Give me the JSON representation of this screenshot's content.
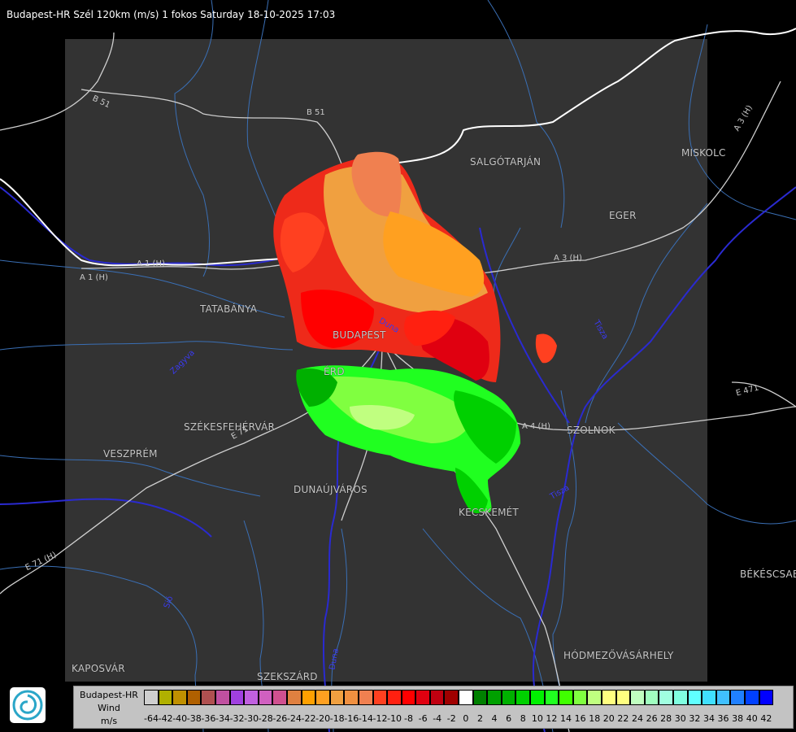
{
  "header": {
    "title": "Budapest-HR Szél 120km (m/s) 1 fokos Saturday 18-10-2025 17:03"
  },
  "map": {
    "cities": [
      {
        "name": "SALGÓTARJÁN"
      },
      {
        "name": "MISKOLC"
      },
      {
        "name": "EGER"
      },
      {
        "name": "TATABÁNYA"
      },
      {
        "name": "BUDAPEST"
      },
      {
        "name": "ÉRD"
      },
      {
        "name": "SZÉKESFEHÉRVÁR"
      },
      {
        "name": "VESZPRÉM"
      },
      {
        "name": "SZOLNOK"
      },
      {
        "name": "DUNAÚJVÁROS"
      },
      {
        "name": "KECSKEMÉT"
      },
      {
        "name": "BÉKÉSCSABA"
      },
      {
        "name": "HÓDMEZŐVÁSÁRHELY"
      },
      {
        "name": "KAPOSVÁR"
      },
      {
        "name": "SZEKSZÁRD"
      }
    ],
    "roads": [
      "B 51",
      "B 51",
      "A 3 (H)",
      "A 3 (H)",
      "A 1 (H)",
      "A 1 (H)",
      "A 4 (H)",
      "E 71",
      "E 71",
      "E 471",
      "E 71 (H)"
    ],
    "rivers": [
      "Duna",
      "Duna",
      "Tisza",
      "Tisza",
      "Zagyva",
      "Sió"
    ],
    "colors": {
      "radar_bg": "#333333",
      "border": "#ffffff",
      "rivers": "#2a2ad0",
      "boundaries": "#3a6fb5",
      "roads": "#cfcfcf"
    }
  },
  "legend": {
    "title": "Budapest-HR",
    "quantity": "Wind",
    "unit": "m/s",
    "ticks": [
      "-64",
      "-42",
      "-40",
      "-38",
      "-36",
      "-34",
      "-32",
      "-30",
      "-28",
      "-26",
      "-24",
      "-22",
      "-20",
      "-18",
      "-16",
      "-14",
      "-12",
      "-10",
      "-8",
      "-6",
      "-4",
      "-2",
      "0",
      "2",
      "4",
      "6",
      "8",
      "10",
      "12",
      "14",
      "16",
      "18",
      "20",
      "22",
      "24",
      "26",
      "28",
      "30",
      "32",
      "34",
      "36",
      "38",
      "40",
      "42"
    ],
    "colors": [
      "#cfcfcf",
      "#b0b000",
      "#c09000",
      "#b06000",
      "#b05050",
      "#c050a0",
      "#a040e0",
      "#c060e0",
      "#d060c0",
      "#d05090",
      "#e08040",
      "#ffa000",
      "#ffa020",
      "#f0a040",
      "#f09040",
      "#f08050",
      "#ff4020",
      "#ff2010",
      "#ff0000",
      "#e00010",
      "#c00010",
      "#a00000",
      "#ffffff",
      "#008000",
      "#00a000",
      "#00b000",
      "#00d000",
      "#00f000",
      "#20ff20",
      "#40ff00",
      "#80ff40",
      "#c0ff80",
      "#ffff80",
      "#ffff80",
      "#c0ffc0",
      "#a0ffc0",
      "#a0ffe0",
      "#80ffe0",
      "#60ffff",
      "#40e0ff",
      "#40c0ff",
      "#2080ff",
      "#0040ff",
      "#0000ff"
    ]
  }
}
